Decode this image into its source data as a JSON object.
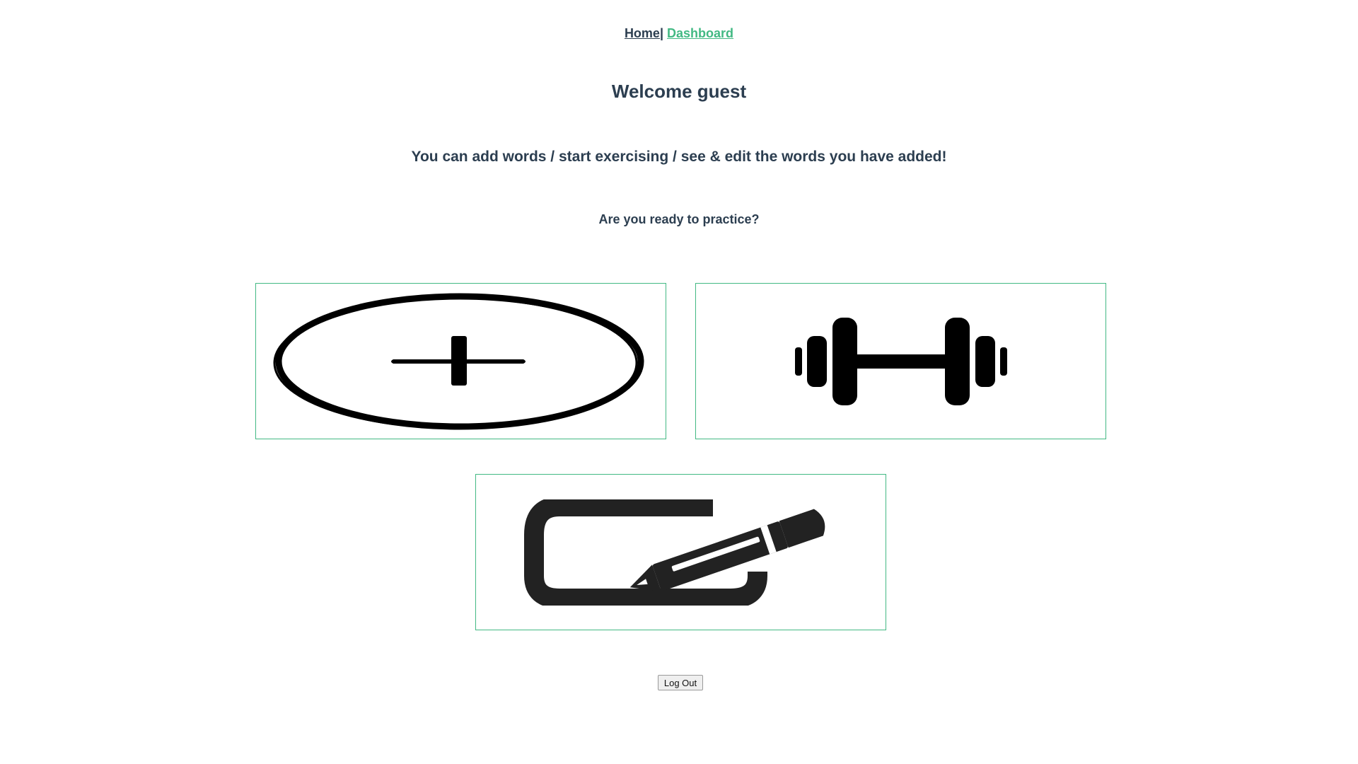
{
  "nav": {
    "home_label": "Home",
    "separator": "|",
    "dashboard_label": "Dashboard"
  },
  "main": {
    "title": "Welcome guest",
    "subtitle": "You can add words / start exercising / see & edit the words you have added!",
    "question": "Are you ready to practice?"
  },
  "cards": {
    "add_icon": "plus-in-ellipse-icon",
    "exercise_icon": "dumbbell-icon",
    "edit_icon": "edit-pencil-icon"
  },
  "actions": {
    "logout_label": "Log Out"
  },
  "colors": {
    "text": "#2c3e50",
    "accent": "#42b983",
    "icon": "#000000"
  }
}
